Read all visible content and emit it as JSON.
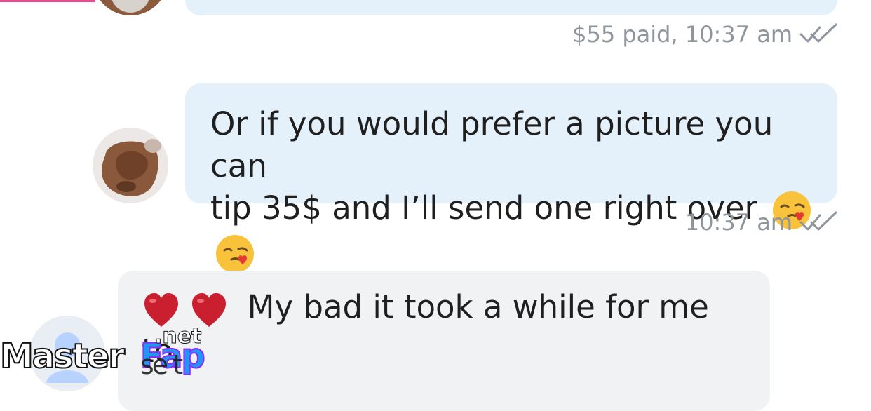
{
  "conversation": {
    "previous_message": {
      "meta": "$55 paid, 10:37 am",
      "status_icon": "double-check-icon"
    },
    "messages": [
      {
        "direction": "outgoing",
        "line_1": "Or if you would prefer a picture you can",
        "line_2": "tip 35$ and I’ll send one right over",
        "emojis": [
          "kiss-heart-icon",
          "kiss-heart-icon"
        ],
        "time": "10:37 am",
        "status_icon": "double-check-icon"
      },
      {
        "direction": "incoming",
        "text": "My bad it took a while for me to",
        "emojis": [
          "heart-icon",
          "heart-icon"
        ]
      }
    ]
  },
  "watermark": {
    "brand": "Master",
    "accent": "Fap",
    "suffix": ".net",
    "overlay": "se t"
  },
  "colors": {
    "outgoing_bubble": "#e4f1fb",
    "incoming_bubble": "#f1f2f4",
    "meta_text": "#8f959c",
    "accent_pink": "#e64a8f"
  }
}
